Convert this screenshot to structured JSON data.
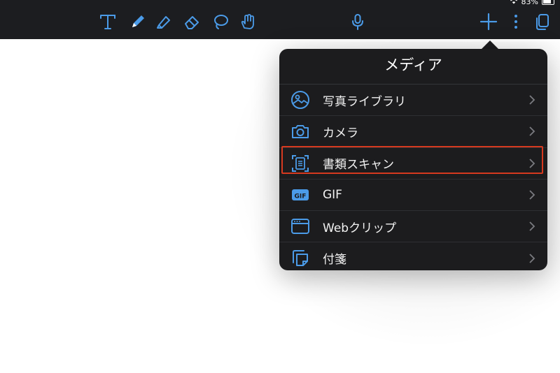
{
  "status_bar": {
    "battery": "83%"
  },
  "toolbar": {
    "tools": [
      {
        "icon": "text-tool-icon"
      },
      {
        "icon": "pen-tool-icon"
      },
      {
        "icon": "highlighter-tool-icon"
      },
      {
        "icon": "eraser-tool-icon"
      },
      {
        "icon": "lasso-tool-icon"
      },
      {
        "icon": "hand-tool-icon"
      },
      {
        "icon": "microphone-icon"
      },
      {
        "icon": "add-icon"
      },
      {
        "icon": "more-icon"
      },
      {
        "icon": "pages-icon"
      }
    ],
    "accent": "#4b9be8"
  },
  "media_menu": {
    "title": "メディア",
    "items": [
      {
        "label": "写真ライブラリ",
        "icon": "photo-library-icon"
      },
      {
        "label": "カメラ",
        "icon": "camera-icon"
      },
      {
        "label": "書類スキャン",
        "icon": "document-scan-icon",
        "highlighted": true
      },
      {
        "label": "GIF",
        "icon": "gif-icon"
      },
      {
        "label": "Webクリップ",
        "icon": "web-clip-icon"
      },
      {
        "label": "付箋",
        "icon": "sticky-note-icon"
      }
    ],
    "highlight_color": "#d6391f"
  }
}
